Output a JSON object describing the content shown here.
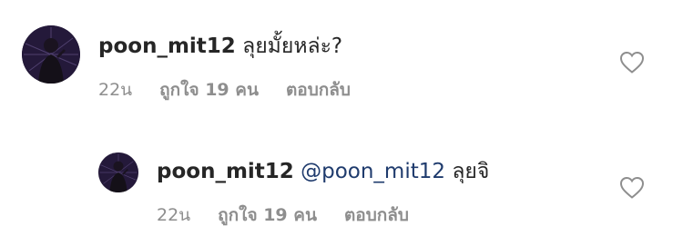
{
  "comments": [
    {
      "username": "poon_mit12",
      "text": "ลุยมั้ยหล่ะ?",
      "time": "22น",
      "likes_label": "ถูกใจ 19 คน",
      "reply_label": "ตอบกลับ",
      "avatar_icon": "profile-avatar",
      "like_icon": "heart-outline-icon"
    }
  ],
  "replies": [
    {
      "username": "poon_mit12",
      "mention": "@poon_mit12",
      "text": "ลุยจิ",
      "time": "22น",
      "likes_label": "ถูกใจ 19 คน",
      "reply_label": "ตอบกลับ",
      "avatar_icon": "profile-avatar",
      "like_icon": "heart-outline-icon"
    }
  ],
  "colors": {
    "text": "#262626",
    "meta": "#8e8e8e",
    "mention": "#1f3b6d"
  }
}
